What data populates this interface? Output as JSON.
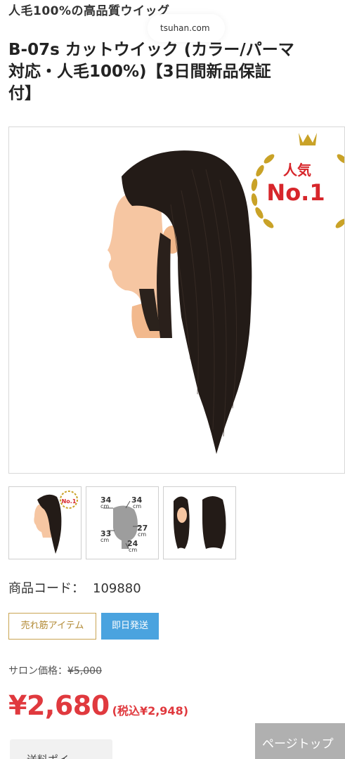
{
  "header": {
    "subtitle": "人毛100%の高品質ウイッグ",
    "url_fragment": "tsuhan.com"
  },
  "product": {
    "title_lines": [
      "B-07s カットウイック (カラー/パーマ",
      "対応・人毛100%)【3日間新品保証",
      "付】"
    ],
    "main_image": {
      "badge_top": "人気",
      "badge_bottom": "No.1",
      "icon": "crown-laurel-icon",
      "colors": {
        "gold": "#c9a227",
        "badge_red": "#d7262b"
      }
    },
    "thumbnails": [
      {
        "name": "thumb-side-view",
        "badge": "No.1"
      },
      {
        "name": "thumb-measurements",
        "measurements": [
          "34",
          "34",
          "33",
          "27",
          "24"
        ],
        "unit": "cm"
      },
      {
        "name": "thumb-front-back"
      }
    ],
    "code_label": "商品コード：",
    "code_value": "109880",
    "badges": {
      "bestseller": "売れ筋アイテム",
      "same_day": "即日発送"
    },
    "salon_label": "サロン価格：",
    "salon_price": "¥5,000",
    "price": "¥2,680",
    "price_tax": "(税込¥2,948)",
    "colors": {
      "price_red": "#e0393e",
      "same_day_blue": "#4aa3df",
      "bestseller_gold": "#c9a452"
    }
  },
  "footer": {
    "bottom_button": "送料ポイ",
    "page_top": "ページトップ"
  }
}
